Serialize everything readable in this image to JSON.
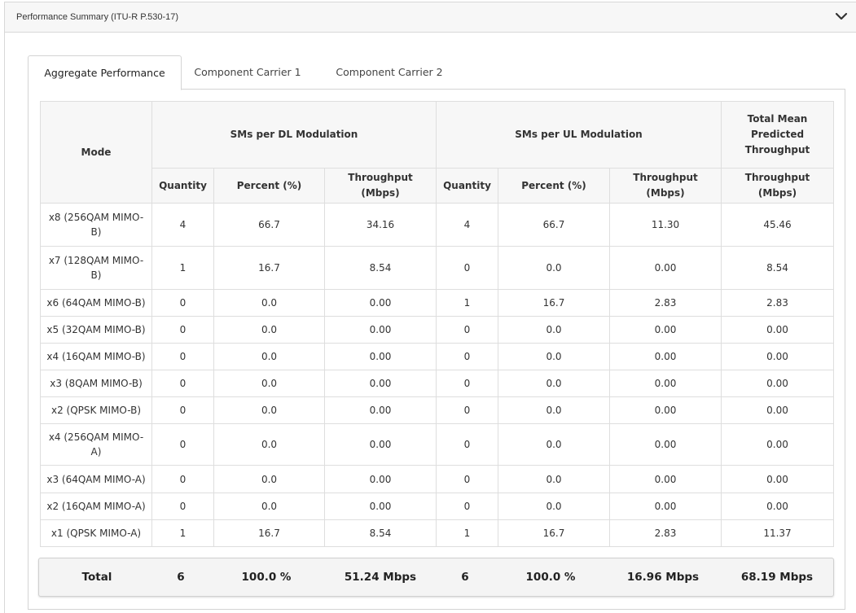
{
  "panel": {
    "title": "Performance Summary (ITU-R P.530-17)",
    "collapse_icon": "chevron-down-icon"
  },
  "tabs": [
    {
      "label": "Aggregate Performance",
      "active": true
    },
    {
      "label": "Component Carrier 1",
      "active": false
    },
    {
      "label": "Component Carrier 2",
      "active": false
    }
  ],
  "table": {
    "headers": {
      "mode": "Mode",
      "dl_group": "SMs per DL Modulation",
      "ul_group": "SMs per UL Modulation",
      "total_group": "Total Mean Predicted Throughput",
      "quantity": "Quantity",
      "percent": "Percent (%)",
      "throughput": "Throughput (Mbps)"
    },
    "rows": [
      {
        "mode": "x8 (256QAM MIMO-B)",
        "dl_qty": "4",
        "dl_pct": "66.7",
        "dl_tp": "34.16",
        "ul_qty": "4",
        "ul_pct": "66.7",
        "ul_tp": "11.30",
        "total": "45.46"
      },
      {
        "mode": "x7 (128QAM MIMO-B)",
        "dl_qty": "1",
        "dl_pct": "16.7",
        "dl_tp": "8.54",
        "ul_qty": "0",
        "ul_pct": "0.0",
        "ul_tp": "0.00",
        "total": "8.54"
      },
      {
        "mode": "x6 (64QAM MIMO-B)",
        "dl_qty": "0",
        "dl_pct": "0.0",
        "dl_tp": "0.00",
        "ul_qty": "1",
        "ul_pct": "16.7",
        "ul_tp": "2.83",
        "total": "2.83"
      },
      {
        "mode": "x5 (32QAM MIMO-B)",
        "dl_qty": "0",
        "dl_pct": "0.0",
        "dl_tp": "0.00",
        "ul_qty": "0",
        "ul_pct": "0.0",
        "ul_tp": "0.00",
        "total": "0.00"
      },
      {
        "mode": "x4 (16QAM MIMO-B)",
        "dl_qty": "0",
        "dl_pct": "0.0",
        "dl_tp": "0.00",
        "ul_qty": "0",
        "ul_pct": "0.0",
        "ul_tp": "0.00",
        "total": "0.00"
      },
      {
        "mode": "x3 (8QAM MIMO-B)",
        "dl_qty": "0",
        "dl_pct": "0.0",
        "dl_tp": "0.00",
        "ul_qty": "0",
        "ul_pct": "0.0",
        "ul_tp": "0.00",
        "total": "0.00"
      },
      {
        "mode": "x2 (QPSK MIMO-B)",
        "dl_qty": "0",
        "dl_pct": "0.0",
        "dl_tp": "0.00",
        "ul_qty": "0",
        "ul_pct": "0.0",
        "ul_tp": "0.00",
        "total": "0.00"
      },
      {
        "mode": "x4 (256QAM MIMO-A)",
        "dl_qty": "0",
        "dl_pct": "0.0",
        "dl_tp": "0.00",
        "ul_qty": "0",
        "ul_pct": "0.0",
        "ul_tp": "0.00",
        "total": "0.00"
      },
      {
        "mode": "x3 (64QAM MIMO-A)",
        "dl_qty": "0",
        "dl_pct": "0.0",
        "dl_tp": "0.00",
        "ul_qty": "0",
        "ul_pct": "0.0",
        "ul_tp": "0.00",
        "total": "0.00"
      },
      {
        "mode": "x2 (16QAM MIMO-A)",
        "dl_qty": "0",
        "dl_pct": "0.0",
        "dl_tp": "0.00",
        "ul_qty": "0",
        "ul_pct": "0.0",
        "ul_tp": "0.00",
        "total": "0.00"
      },
      {
        "mode": "x1 (QPSK MIMO-A)",
        "dl_qty": "1",
        "dl_pct": "16.7",
        "dl_tp": "8.54",
        "ul_qty": "1",
        "ul_pct": "16.7",
        "ul_tp": "2.83",
        "total": "11.37"
      }
    ]
  },
  "totals": {
    "label": "Total",
    "dl_qty": "6",
    "dl_pct": "100.0 %",
    "dl_tp": "51.24 Mbps",
    "ul_qty": "6",
    "ul_pct": "100.0 %",
    "ul_tp": "16.96 Mbps",
    "total": "68.19 Mbps"
  }
}
